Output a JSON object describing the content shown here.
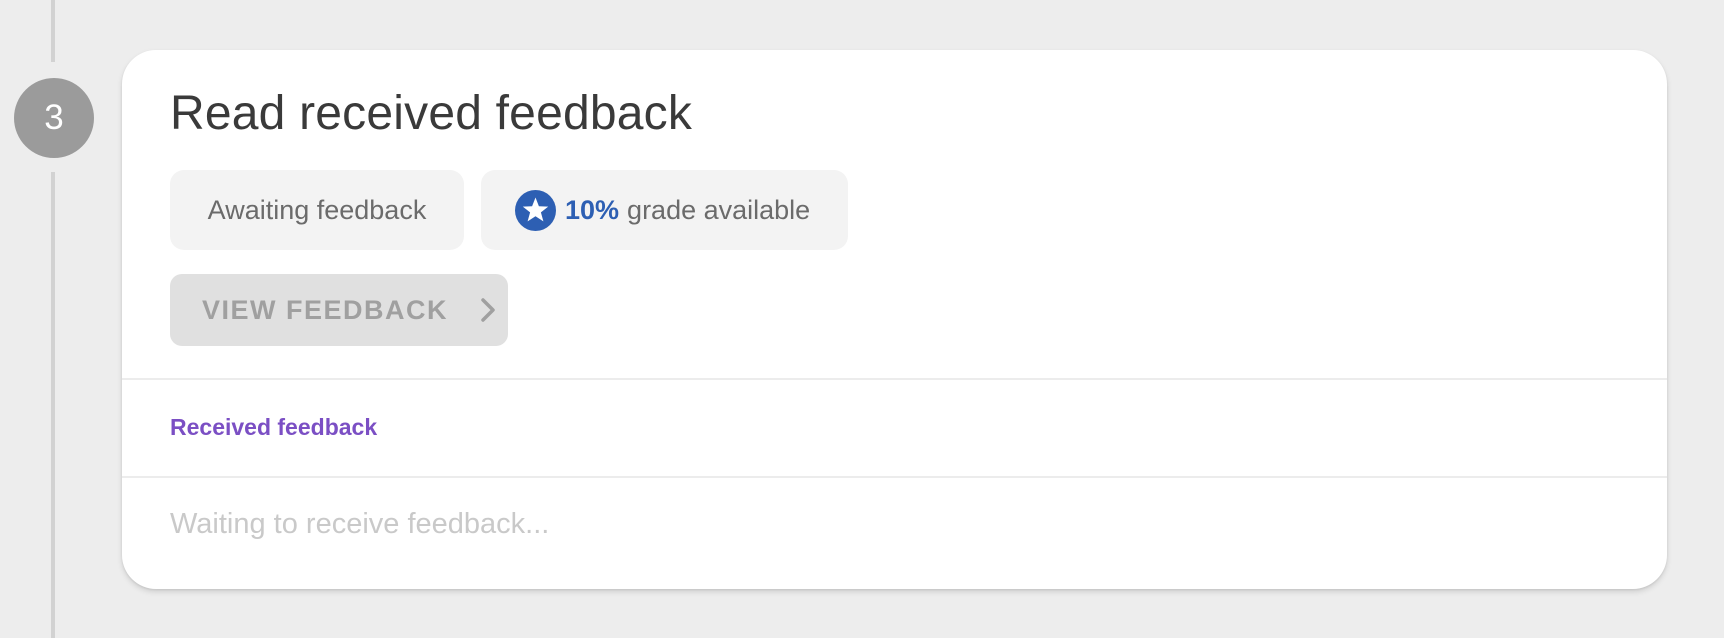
{
  "step": {
    "number": "3"
  },
  "card": {
    "title": "Read received feedback",
    "status_chip": "Awaiting feedback",
    "grade_chip": {
      "percent": "10%",
      "text": "grade available",
      "icon": "star-icon"
    },
    "view_button": {
      "label": "VIEW FEEDBACK",
      "icon": "chevron-right-icon",
      "enabled": false
    },
    "section_label": "Received feedback",
    "placeholder": "Waiting to receive feedback..."
  },
  "colors": {
    "background": "#ededed",
    "card": "#ffffff",
    "step_circle": "#9b9b9b",
    "grade_accent": "#2d5fb3",
    "section_label": "#7b4fc4",
    "disabled_button": "#e0e0e0"
  }
}
